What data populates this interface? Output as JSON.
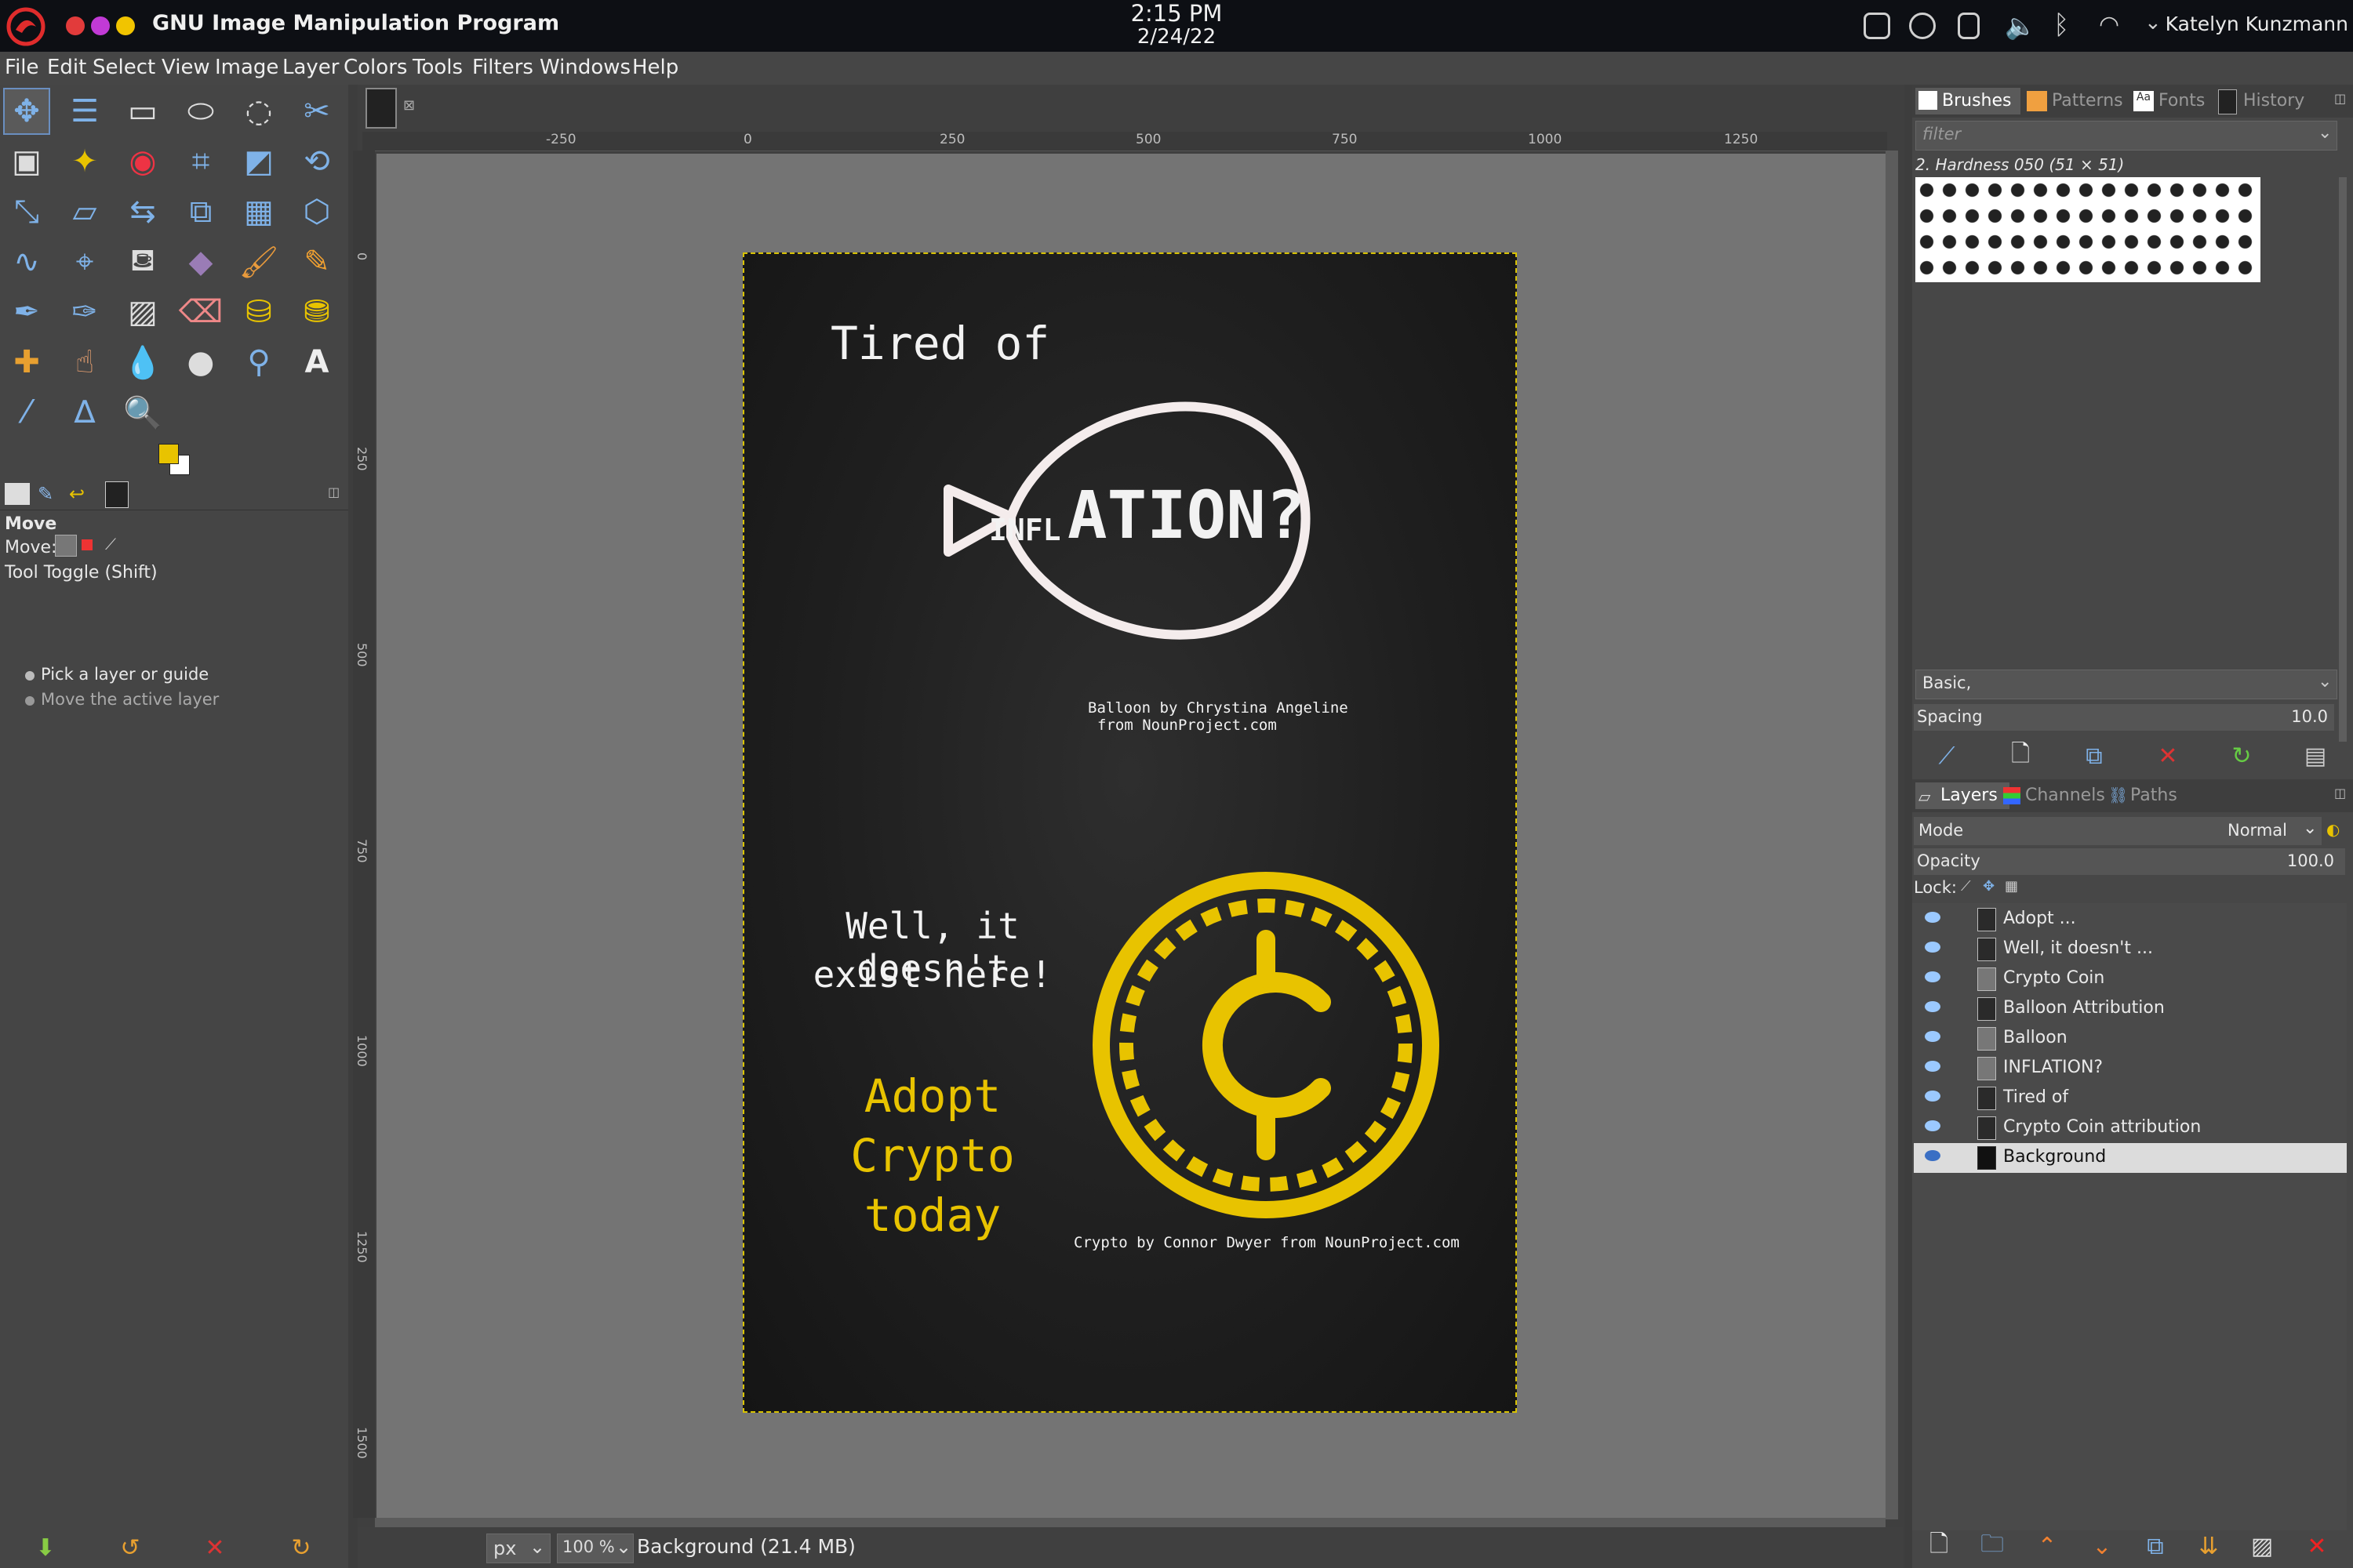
{
  "system": {
    "app_title": "GNU Image Manipulation Program",
    "time": "2:15 PM",
    "date": "2/24/22",
    "user": "Katelyn Kunzmann",
    "window_dots": [
      "#e23b3b",
      "#c13ad6",
      "#f1c400"
    ]
  },
  "menu": [
    "File",
    "Edit",
    "Select",
    "View",
    "Image",
    "Layer",
    "Colors",
    "Tools",
    "Filters",
    "Windows",
    "Help"
  ],
  "tool_options": {
    "title": "Move",
    "move_label": "Move:",
    "toggle_label": "Tool Toggle  (Shift)",
    "option1": "Pick a layer or guide",
    "option2": "Move the active layer"
  },
  "rulers": {
    "top": [
      "-250",
      "0",
      "250",
      "500",
      "750",
      "1000",
      "1250"
    ],
    "left": [
      "0",
      "250",
      "500",
      "750",
      "1000",
      "1250",
      "1500"
    ]
  },
  "poster": {
    "headline": "Tired of",
    "inflation_small": "INFL",
    "inflation_big": "ATION?",
    "balloon_credit_1": "Balloon by Chrystina Angeline",
    "balloon_credit_2": "from NounProject.com",
    "line1": "Well, it doesn't",
    "line2": "exist here!",
    "adopt1": "Adopt",
    "adopt2": "Crypto",
    "adopt3": "today",
    "coin_credit": "Crypto by Connor Dwyer from NounProject.com",
    "accent": "#e8c300"
  },
  "status": {
    "unit": "px",
    "zoom": "100 %",
    "info": "Background (21.4 MB)"
  },
  "brushes": {
    "tabs": [
      "Brushes",
      "Patterns",
      "Fonts",
      "History"
    ],
    "filter_placeholder": "filter",
    "selected": "2. Hardness 050 (51 × 51)",
    "preset": "Basic,",
    "spacing_label": "Spacing",
    "spacing_value": "10.0"
  },
  "layers": {
    "tabs": [
      "Layers",
      "Channels",
      "Paths"
    ],
    "mode_label": "Mode",
    "mode_value": "Normal",
    "opacity_label": "Opacity",
    "opacity_value": "100.0",
    "lock_label": "Lock:",
    "items": [
      "Adopt ...",
      "Well, it doesn't ...",
      "Crypto Coin",
      "Balloon Attribution",
      "Balloon",
      "INFLATION?",
      "Tired of",
      "Crypto Coin attribution",
      "Background"
    ],
    "selected": "Background"
  }
}
